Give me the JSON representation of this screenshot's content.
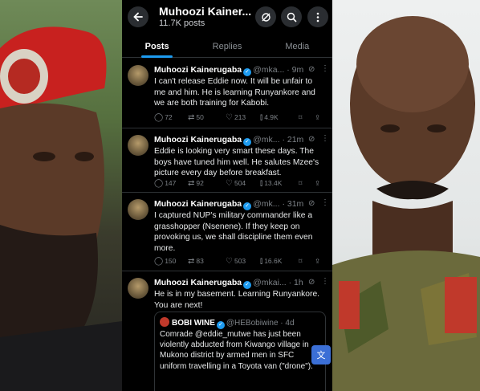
{
  "header": {
    "title": "Muhoozi Kainer...",
    "subtitle": "11.7K posts",
    "icons": [
      "back-arrow-icon",
      "grok-icon",
      "search-icon",
      "more-vertical-icon"
    ]
  },
  "tabs": [
    {
      "label": "Posts",
      "active": true
    },
    {
      "label": "Replies",
      "active": false
    },
    {
      "label": "Media",
      "active": false
    }
  ],
  "tweets": [
    {
      "name": "Muhoozi Kainerugaba",
      "handle": "@mka...",
      "time": "· 9m",
      "text": "I can't release Eddie now. It will be unfair to me and him. He is learning Runyankore and we are both training for Kabobi.",
      "replies": "72",
      "retweets": "50",
      "likes": "213",
      "views": "4.9K"
    },
    {
      "name": "Muhoozi Kainerugaba",
      "handle": "@mk...",
      "time": "· 21m",
      "text": "Eddie is looking very smart these days. The boys have tuned him well. He salutes Mzee's picture every day before breakfast.",
      "replies": "147",
      "retweets": "92",
      "likes": "504",
      "views": "13.4K"
    },
    {
      "name": "Muhoozi Kainerugaba",
      "handle": "@mk...",
      "time": "· 31m",
      "text": "I captured NUP's military commander like a grasshopper (Nsenene). If they keep on provoking us, we shall discipline them even more.",
      "replies": "150",
      "retweets": "83",
      "likes": "503",
      "views": "16.6K"
    },
    {
      "name": "Muhoozi Kainerugaba",
      "handle": "@mkai...",
      "time": "· 1h",
      "text": "He is in my basement. Learning Runyankore. You are next!",
      "quote": {
        "name": "BOBI WINE",
        "handle": "@HEBobiwine",
        "time": "· 4d",
        "text": "Comrade @eddie_mutwe has just been violently abducted from Kiwango village in Mukono district by armed men in SFC uniform travelling in a Toyota van (\"drone\")."
      }
    }
  ],
  "colors": {
    "accent": "#1d9bf0",
    "background": "#000000",
    "text": "#e7e9ea",
    "muted": "#7d8287"
  }
}
